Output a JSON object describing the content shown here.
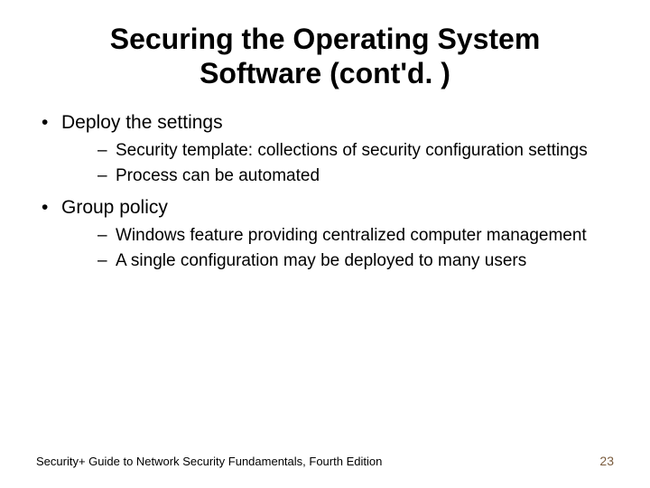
{
  "title_line1": "Securing the Operating System",
  "title_line2": "Software (cont'd. )",
  "bullets": {
    "b1": {
      "text": "Deploy the settings",
      "sub1": "Security template: collections of security configuration settings",
      "sub2": "Process can be automated"
    },
    "b2": {
      "text": "Group policy",
      "sub1": "Windows feature providing centralized computer management",
      "sub2": "A single configuration may be deployed to many users"
    }
  },
  "footer": {
    "source": "Security+ Guide to Network Security Fundamentals, Fourth Edition",
    "page": "23"
  }
}
